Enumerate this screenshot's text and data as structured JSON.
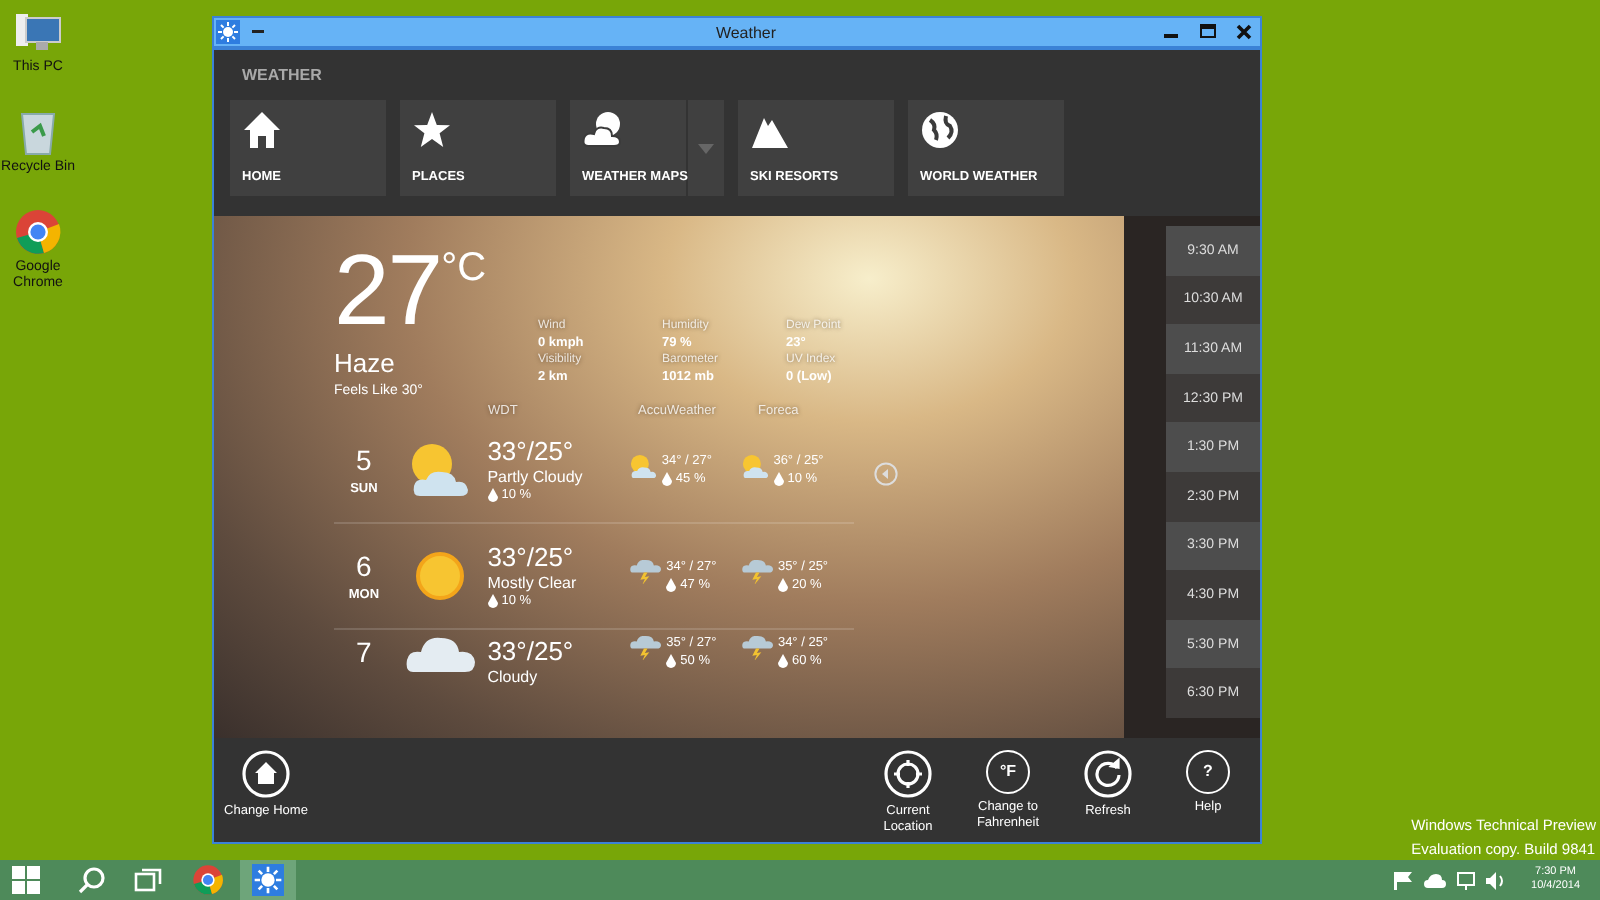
{
  "desktop_icons": [
    {
      "label": "This PC",
      "kind": "pc"
    },
    {
      "label": "Recycle Bin",
      "kind": "bin"
    },
    {
      "label": "Google Chrome",
      "kind": "browser"
    }
  ],
  "window": {
    "title": "Weather"
  },
  "header": {
    "title": "WEATHER"
  },
  "nav": [
    {
      "label": "HOME",
      "kind": "home",
      "dropdown": false
    },
    {
      "label": "PLACES",
      "kind": "star",
      "dropdown": false
    },
    {
      "label": "WEATHER MAPS",
      "kind": "cloud-sun",
      "dropdown": true
    },
    {
      "label": "SKI RESORTS",
      "kind": "mountain",
      "dropdown": false
    },
    {
      "label": "WORLD WEATHER",
      "kind": "globe",
      "dropdown": false
    }
  ],
  "current": {
    "temperature": "27",
    "unit": "°C",
    "condition": "Haze",
    "feels_like": "Feels Like 30°",
    "stats": [
      {
        "label": "Wind",
        "value": "0 kmph"
      },
      {
        "label": "Humidity",
        "value": "79 %"
      },
      {
        "label": "Dew Point",
        "value": "23°"
      },
      {
        "label": "Visibility",
        "value": "2 km"
      },
      {
        "label": "Barometer",
        "value": "1012 mb"
      },
      {
        "label": "UV Index",
        "value": "0 (Low)"
      }
    ]
  },
  "forecast_sources": [
    "WDT",
    "AccuWeather",
    "Foreca"
  ],
  "forecast": [
    {
      "day": "5",
      "weekday": "SUN",
      "kind": "partly-cloudy",
      "temps": "33°/25°",
      "condition": "Partly Cloudy",
      "precip": "10 %",
      "sources": [
        {
          "kind": "partly-cloudy",
          "temps": "34° / 27°",
          "precip": "45 %"
        },
        {
          "kind": "partly-cloudy",
          "temps": "36° / 25°",
          "precip": "10 %"
        }
      ]
    },
    {
      "day": "6",
      "weekday": "MON",
      "kind": "sun",
      "temps": "33°/25°",
      "condition": "Mostly Clear",
      "precip": "10 %",
      "sources": [
        {
          "kind": "storm",
          "temps": "34° / 27°",
          "precip": "47 %"
        },
        {
          "kind": "storm",
          "temps": "35° / 25°",
          "precip": "20 %"
        }
      ]
    },
    {
      "day": "7",
      "kind": "cloud",
      "temps": "33°/25°",
      "condition": "Cloudy",
      "sources": [
        {
          "kind": "storm",
          "temps": "35° / 27°",
          "precip": "50 %"
        },
        {
          "kind": "storm",
          "temps": "34° / 25°",
          "precip": "60 %"
        }
      ]
    }
  ],
  "hours": [
    "9:30 AM",
    "10:30 AM",
    "11:30 AM",
    "12:30 PM",
    "1:30 PM",
    "2:30 PM",
    "3:30 PM",
    "4:30 PM",
    "5:30 PM",
    "6:30 PM"
  ],
  "commands_left": [
    {
      "label": "Change Home",
      "kind": "home"
    }
  ],
  "commands_right": [
    {
      "label": "Current Location",
      "kind": "target"
    },
    {
      "label": "Change to Fahrenheit",
      "kind": "text",
      "glyph": "°F"
    },
    {
      "label": "Refresh",
      "kind": "refresh"
    },
    {
      "label": "Help",
      "kind": "text",
      "glyph": "?"
    }
  ],
  "build_notice": [
    "Windows Technical Preview",
    "Evaluation copy. Build 9841"
  ],
  "taskbar": {
    "apps": [
      {
        "kind": "browser",
        "selected": false
      },
      {
        "kind": "weather",
        "selected": true
      }
    ],
    "time": "7:30 PM",
    "date": "10/4/2014"
  }
}
